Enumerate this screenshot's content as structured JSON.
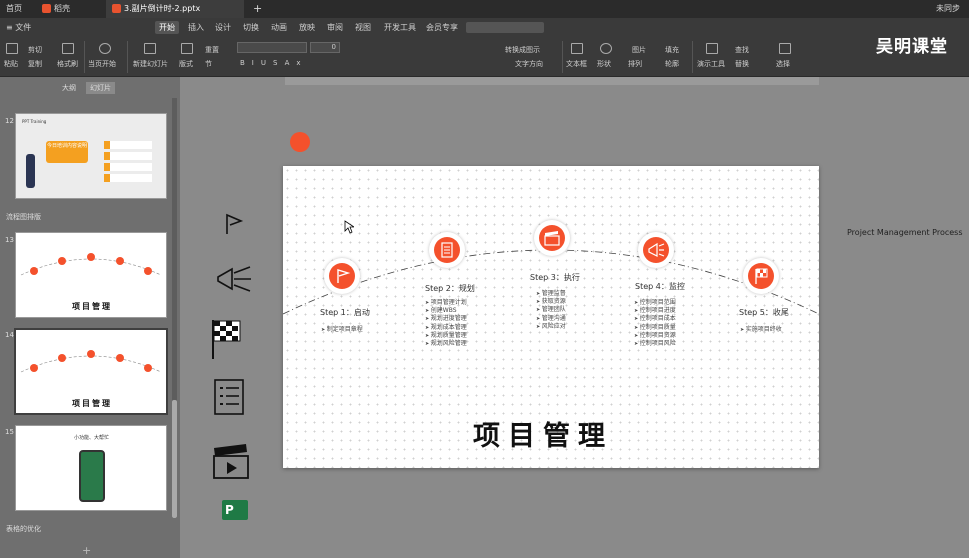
{
  "titlebar": {
    "tabs": [
      {
        "label": "首页"
      },
      {
        "label": "稻壳"
      },
      {
        "label": "3.副片倒计时-2.pptx"
      }
    ],
    "new_tab": "+",
    "user": "未同步"
  },
  "menu": {
    "file": "≡ 文件",
    "items": [
      "开始",
      "插入",
      "设计",
      "切换",
      "动画",
      "放映",
      "审阅",
      "视图",
      "开发工具",
      "会员专享"
    ],
    "active": "开始"
  },
  "ribbon": {
    "paste": "粘贴",
    "format_painter": "格式刷",
    "cut": "剪切",
    "copy": "复制",
    "from_start": "当页开始",
    "new_slide": "新建幻灯片",
    "layout": "版式",
    "section": "节",
    "reset": "重置",
    "font_size_value": "0",
    "text_box": "文本框",
    "shape": "形状",
    "arrange": "排列",
    "picture": "图片",
    "fill": "填充",
    "present_tool": "演示工具",
    "find": "查找",
    "replace": "替换",
    "select": "选择",
    "outline": "轮廓",
    "convert_smartart": "转换成图示",
    "text_to": "文字方向"
  },
  "left_panel": {
    "tab_outline": "大纲",
    "tab_slides": "幻灯片",
    "slides": [
      {
        "num": "12",
        "title": "今日培训内容说明"
      },
      {
        "num": "13",
        "title": "项目管理"
      },
      {
        "num": "14",
        "title": "项目管理"
      },
      {
        "num": "15",
        "title": "小功能、大帮忙"
      }
    ],
    "sections": [
      "流程图排版",
      "表格的优化"
    ],
    "slide12_top": "PPT Training"
  },
  "slide": {
    "title": "项目管理",
    "steps": [
      {
        "title": "Step 1：启动",
        "items": [
          "制定项目章程"
        ]
      },
      {
        "title": "Step 2：规划",
        "items": [
          "项目管理计划",
          "创建WBS",
          "规划进度管理",
          "规划成本管理",
          "规划质量管理",
          "规划风险管理"
        ]
      },
      {
        "title": "Step 3：执行",
        "items": [
          "管理监督",
          "获取资源",
          "管理团队",
          "管理沟通",
          "风险应对"
        ]
      },
      {
        "title": "Step 4：监控",
        "items": [
          "控制项目范围",
          "控制项目进度",
          "控制项目成本",
          "控制项目质量",
          "控制项目资源",
          "控制项目风险"
        ]
      },
      {
        "title": "Step 5：收尾",
        "items": [
          "实施项目终收"
        ]
      }
    ]
  },
  "side_note": "Project Management Process",
  "watermark": "吴明课堂",
  "colors": {
    "accent": "#f4512c"
  }
}
